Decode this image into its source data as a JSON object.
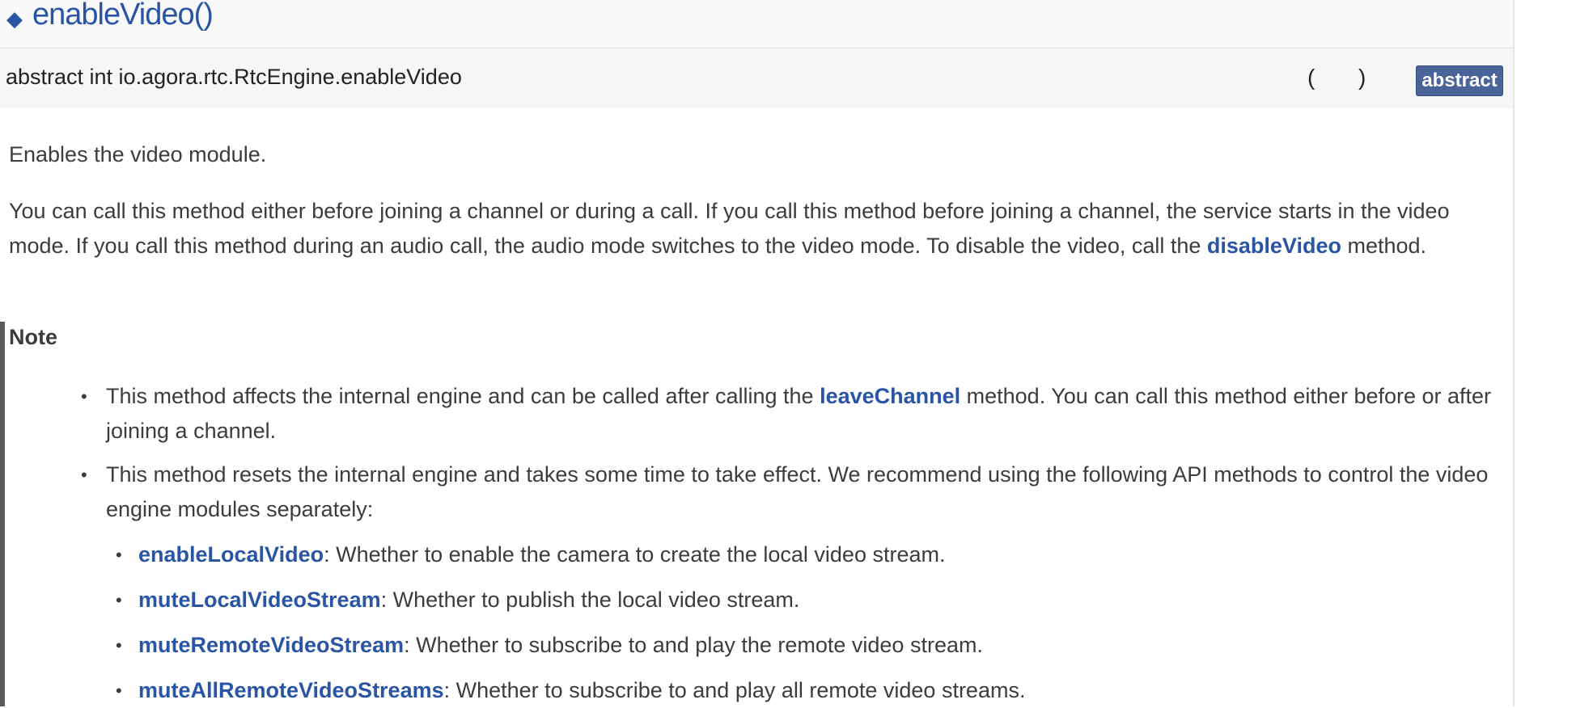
{
  "member": {
    "title": "enableVideo()",
    "title_marker": "◆",
    "prototype": "abstract int io.agora.rtc.RtcEngine.enableVideo",
    "paren_open": "(",
    "paren_close": ")",
    "badge": "abstract"
  },
  "description": {
    "summary": "Enables the video module.",
    "detail_pre": "You can call this method either before joining a channel or during a call. If you call this method before joining a channel, the service starts in the video mode. If you call this method during an audio call, the audio mode switches to the video mode. To disable the video, call the ",
    "detail_link": "disableVideo",
    "detail_post": " method."
  },
  "note": {
    "title": "Note",
    "bullets": [
      {
        "pre": "This method affects the internal engine and can be called after calling the ",
        "link": "leaveChannel",
        "post": " method. You can call this method either before or after joining a channel."
      },
      {
        "text": "This method resets the internal engine and takes some time to take effect. We recommend using the following API methods to control the video engine modules separately:"
      }
    ],
    "sub_items": [
      {
        "link": "enableLocalVideo",
        "text": ": Whether to enable the camera to create the local video stream."
      },
      {
        "link": "muteLocalVideoStream",
        "text": ": Whether to publish the local video stream."
      },
      {
        "link": "muteRemoteVideoStream",
        "text": ": Whether to subscribe to and play the remote video stream."
      },
      {
        "link": "muteAllRemoteVideoStreams",
        "text": ": Whether to subscribe to and play all remote video streams."
      }
    ],
    "bullet_glyph": "•"
  },
  "colors": {
    "link": "#2a55a5",
    "badge_bg": "#4a6398",
    "text": "#3c3c3c"
  }
}
